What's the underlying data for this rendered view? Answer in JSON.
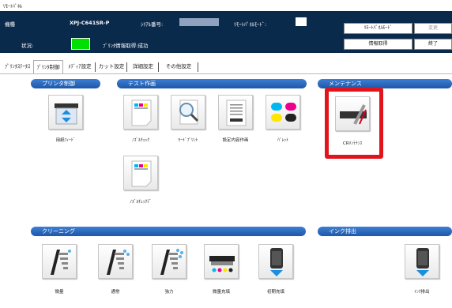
{
  "window": {
    "title": "ﾘﾓｰﾄﾊﾟﾈﾙ"
  },
  "header": {
    "model_label": "機種",
    "model_value": "XPJ-C641SR-P",
    "serial_label": "ｼﾘｱﾙ番号:",
    "remote_label": "ﾘﾓｰﾄﾊﾟﾈﾙﾓｰﾄﾞ:",
    "status_label": "状況:",
    "status_text": "ﾌﾟﾘﾝﾀ情報取得:成功",
    "status_color": "#00e000",
    "buttons": {
      "remote_mode": "ﾘﾓｰﾄﾊﾟﾈﾙﾓｰﾄﾞ",
      "change": "変更",
      "get_info": "情報取得",
      "exit": "終了"
    }
  },
  "tabs": [
    {
      "label": "ﾌﾟﾘﾝﾀｽﾃｰﾀｽ"
    },
    {
      "label": "ﾌﾟﾘﾝﾀ制御"
    },
    {
      "label": "ﾒﾃﾞｨｱ設定"
    },
    {
      "label": "カット設定"
    },
    {
      "label": "詳細設定"
    },
    {
      "label": "その他設定"
    }
  ],
  "sections": {
    "printer_control": {
      "title": "プリンタ制御",
      "buttons": [
        {
          "label": "用紙ﾌｨｰﾄﾞ",
          "icon": "paper-feed-icon"
        }
      ]
    },
    "test_print": {
      "title": "テスト作画",
      "buttons": [
        {
          "label": "ﾉｽﾞﾙﾁｪｯｸ",
          "icon": "nozzle-check-icon"
        },
        {
          "label": "ﾓｰﾄﾞﾌﾟﾘﾝﾄ",
          "icon": "mode-print-icon"
        },
        {
          "label": "設定内容作画",
          "icon": "settings-print-icon"
        },
        {
          "label": "ﾊﾟﾚｯﾄ",
          "icon": "palette-icon"
        },
        {
          "label": "ﾉｽﾞﾙﾁｪｯｸﾃﾞ",
          "icon": "nozzle-check-2-icon"
        }
      ]
    },
    "maintenance": {
      "title": "メンテナンス",
      "buttons": [
        {
          "label": "CRﾒﾝﾃﾅﾝｽ",
          "icon": "cr-maintenance-icon"
        }
      ]
    },
    "cleaning": {
      "title": "クリーニング",
      "buttons": [
        {
          "label": "微量",
          "icon": "cleaning-light-icon"
        },
        {
          "label": "通常",
          "icon": "cleaning-normal-icon"
        },
        {
          "label": "強力",
          "icon": "cleaning-strong-icon"
        },
        {
          "label": "微量充填",
          "icon": "ink-fill-light-icon"
        },
        {
          "label": "初期充填",
          "icon": "initial-fill-icon"
        }
      ]
    },
    "ink_discharge": {
      "title": "インク排出",
      "buttons": [
        {
          "label": "ｲﾝｸ排出",
          "icon": "ink-discharge-icon"
        }
      ]
    }
  },
  "colors": {
    "header_bg": "#0a2a4c",
    "section_hdr": "#1d57a8",
    "highlight_frame": "#e1141b"
  }
}
